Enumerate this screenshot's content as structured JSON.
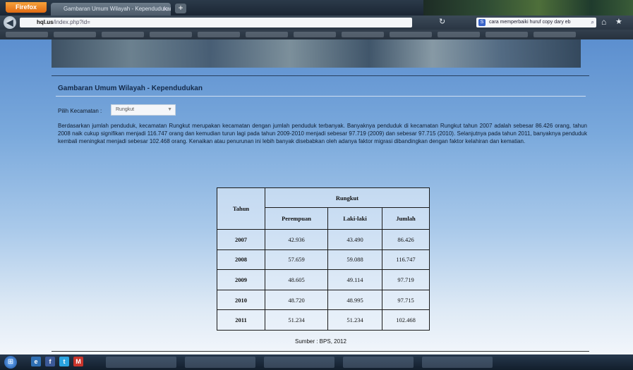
{
  "browser": {
    "app_button": "Firefox",
    "tab_title": "Gambaran Umum Wilayah - Kependudukan",
    "url_host": "hql.us",
    "url_rest": "/index.php?id=",
    "search_text": "cara memperbaiki huruf copy dary eb"
  },
  "page": {
    "section_title": "Gambaran Umum Wilayah - Kependudukan",
    "select_label": "Pilih Kecamatan :",
    "select_value": "Rungkut",
    "paragraph": "Berdasarkan jumlah penduduk, kecamatan Rungkut merupakan kecamatan dengan jumlah penduduk terbanyak. Banyaknya penduduk di kecamatan Rungkut tahun 2007 adalah sebesar 86.426 orang, tahun 2008 naik cukup signifikan menjadi 116.747 orang dan kemudian turun lagi pada tahun 2009-2010 menjadi sebesar 97.719 (2009) dan sebesar 97.715 (2010). Selanjutnya pada tahun 2011, banyaknya penduduk kembali meningkat menjadi sebesar 102.468 orang. Kenaikan atau penurunan ini lebih banyak disebabkan oleh adanya faktor migrasi dibandingkan dengan faktor kelahiran dan kematian.",
    "table": {
      "col_year": "Tahun",
      "group_header": "Rungkut",
      "col_female": "Perempuan",
      "col_male": "Laki-laki",
      "col_total": "Jumlah",
      "rows": [
        {
          "year": "2007",
          "female": "42.936",
          "male": "43.490",
          "total": "86.426"
        },
        {
          "year": "2008",
          "female": "57.659",
          "male": "59.088",
          "total": "116.747"
        },
        {
          "year": "2009",
          "female": "48.605",
          "male": "49.114",
          "total": "97.719"
        },
        {
          "year": "2010",
          "female": "48.720",
          "male": "48.995",
          "total": "97.715"
        },
        {
          "year": "2011",
          "female": "51.234",
          "male": "51.234",
          "total": "102.468"
        }
      ]
    },
    "source": "Sumber : BPS, 2012"
  },
  "taskbar": {
    "icons": [
      "ie-icon",
      "facebook-icon",
      "twitter-icon",
      "gmail-icon"
    ]
  }
}
